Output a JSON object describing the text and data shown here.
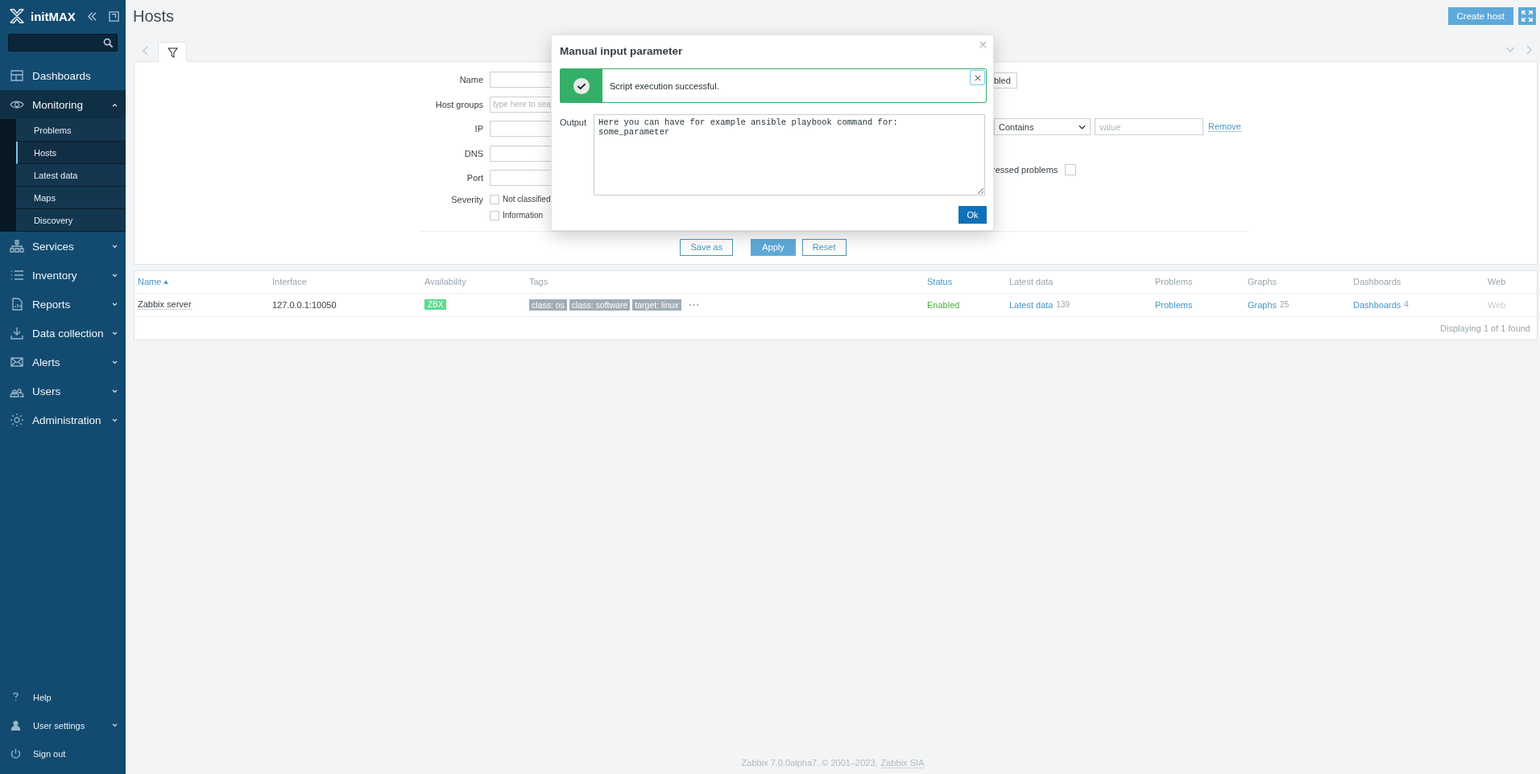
{
  "sidebar": {
    "brand": "initMAX",
    "menu": [
      {
        "label": "Dashboards",
        "kind": "dashboards",
        "submenu": false,
        "expanded": false
      },
      {
        "label": "Monitoring",
        "kind": "monitoring",
        "submenu": true,
        "expanded": true,
        "children": [
          {
            "label": "Problems",
            "selected": false
          },
          {
            "label": "Hosts",
            "selected": true
          },
          {
            "label": "Latest data",
            "selected": false
          },
          {
            "label": "Maps",
            "selected": false
          },
          {
            "label": "Discovery",
            "selected": false
          }
        ]
      },
      {
        "label": "Services",
        "kind": "services",
        "submenu": true,
        "expanded": false
      },
      {
        "label": "Inventory",
        "kind": "inventory",
        "submenu": true,
        "expanded": false
      },
      {
        "label": "Reports",
        "kind": "reports",
        "submenu": true,
        "expanded": false
      },
      {
        "label": "Data collection",
        "kind": "datacollection",
        "submenu": true,
        "expanded": false
      },
      {
        "label": "Alerts",
        "kind": "alerts",
        "submenu": true,
        "expanded": false
      },
      {
        "label": "Users",
        "kind": "users",
        "submenu": true,
        "expanded": false
      },
      {
        "label": "Administration",
        "kind": "administration",
        "submenu": true,
        "expanded": false
      }
    ],
    "bottom": [
      {
        "label": "Help",
        "kind": "help",
        "submenu": false
      },
      {
        "label": "User settings",
        "kind": "user",
        "submenu": true
      },
      {
        "label": "Sign out",
        "kind": "signout",
        "submenu": false
      }
    ]
  },
  "header": {
    "title": "Hosts",
    "create_button": "Create host"
  },
  "filter": {
    "fields": [
      {
        "label": "Name"
      },
      {
        "label": "Host groups",
        "placeholder": "type here to sea"
      },
      {
        "label": "IP"
      },
      {
        "label": "DNS"
      },
      {
        "label": "Port"
      }
    ],
    "severity": {
      "label": "Severity",
      "options": [
        {
          "label": "Not classified",
          "checked": false
        },
        {
          "label": "Information",
          "checked": false
        }
      ]
    },
    "status_fragment": "bled",
    "tag_operator": "Contains",
    "tag_value_placeholder": "value",
    "remove_link": "Remove",
    "suppressed": {
      "label": "ressed problems",
      "checked": false
    },
    "buttons": {
      "save_as": "Save as",
      "apply": "Apply",
      "reset": "Reset"
    }
  },
  "dialog": {
    "title": "Manual input parameter",
    "message": {
      "kind": "success",
      "text": "Script execution successful."
    },
    "output_label": "Output",
    "output": "Here you can have for example ansible playbook command for:\nsome_parameter",
    "ok": "Ok"
  },
  "table": {
    "columns": [
      {
        "label": "Name",
        "sortable": true,
        "sorted": true
      },
      {
        "label": "Interface",
        "sortable": false,
        "sorted": false
      },
      {
        "label": "Availability",
        "sortable": false,
        "sorted": false
      },
      {
        "label": "Tags",
        "sortable": false,
        "sorted": false
      },
      {
        "label": "Status",
        "sortable": true,
        "sorted": false
      },
      {
        "label": "Latest data",
        "sortable": false,
        "sorted": false
      },
      {
        "label": "Problems",
        "sortable": false,
        "sorted": false
      },
      {
        "label": "Graphs",
        "sortable": false,
        "sorted": false
      },
      {
        "label": "Dashboards",
        "sortable": false,
        "sorted": false
      },
      {
        "label": "Web",
        "sortable": false,
        "sorted": false
      }
    ],
    "rows": [
      {
        "name": "Zabbix server",
        "interface": "127.0.0.1:10050",
        "availability": [
          {
            "label": "ZBX",
            "color": "#59db8f"
          }
        ],
        "tags": [
          "class: os",
          "class: software",
          "target: linux"
        ],
        "status": {
          "text": "Enabled",
          "kind": "enabled"
        },
        "latest": {
          "label": "Latest data",
          "count": "139"
        },
        "problems": {
          "label": "Problems"
        },
        "graphs": {
          "label": "Graphs",
          "count": "25"
        },
        "dashboards": {
          "label": "Dashboards",
          "count": "4"
        },
        "web": {
          "label": "Web",
          "disabled": true
        }
      }
    ],
    "footer": "Displaying 1 of 1 found"
  },
  "footer": {
    "text": "Zabbix 7.0.0alpha7. © 2001–2023,",
    "link": "Zabbix SIA"
  }
}
